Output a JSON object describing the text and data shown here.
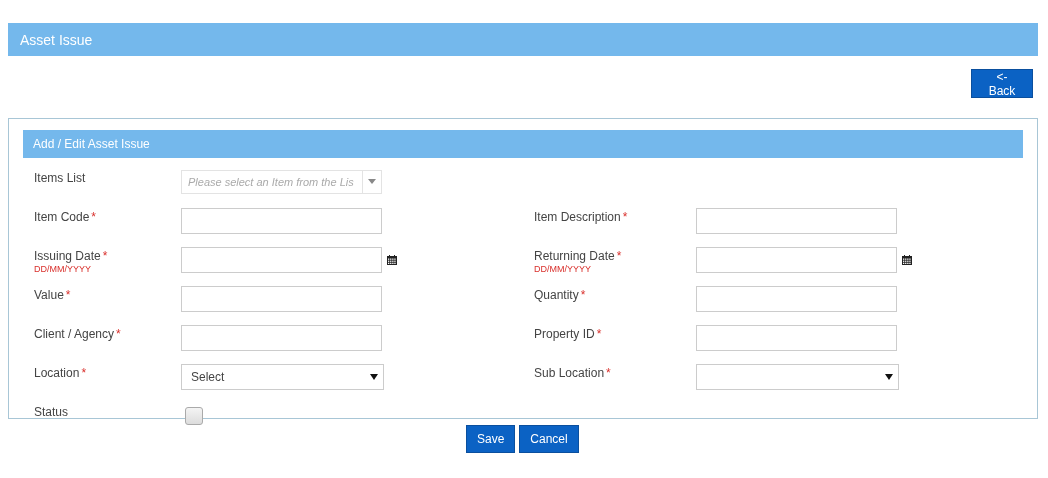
{
  "page_title": "Asset Issue",
  "back_button": "<- Back",
  "form": {
    "title": "Add / Edit Asset Issue",
    "rows": [
      [
        {
          "kind": "combo",
          "label": "Items List",
          "placeholder": "Please select an Item from the Lis"
        }
      ],
      [
        {
          "kind": "text",
          "label": "Item Code",
          "required": "*"
        },
        {
          "kind": "text",
          "label": "Item Description",
          "required": "*"
        }
      ],
      [
        {
          "kind": "date",
          "label": "Issuing Date",
          "required": "*",
          "hint": "DD/MM/YYYY"
        },
        {
          "kind": "date",
          "label": "Returning Date",
          "required": "*",
          "hint": "DD/MM/YYYY"
        }
      ],
      [
        {
          "kind": "text",
          "label": "Value",
          "required": "*"
        },
        {
          "kind": "text",
          "label": "Quantity",
          "required": "*"
        }
      ],
      [
        {
          "kind": "text",
          "label": "Client / Agency",
          "required": "*"
        },
        {
          "kind": "text",
          "label": "Property ID",
          "required": "*"
        }
      ],
      [
        {
          "kind": "select",
          "label": "Location",
          "required": "*",
          "value": "Select"
        },
        {
          "kind": "select",
          "label": "Sub Location",
          "required": "*"
        }
      ],
      [
        {
          "kind": "checkbox",
          "label": "Status",
          "checked": false
        }
      ]
    ]
  },
  "buttons": [
    "Save",
    "Cancel"
  ]
}
